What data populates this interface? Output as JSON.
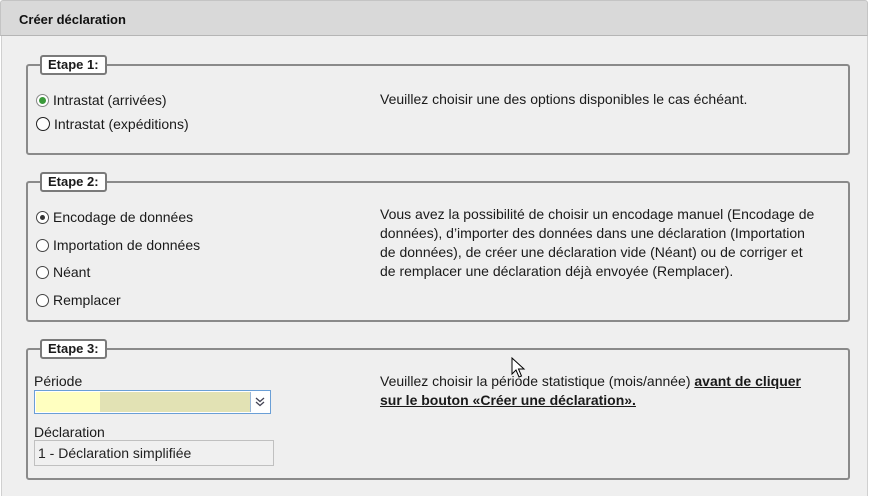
{
  "header": {
    "title": "Créer déclaration"
  },
  "step1": {
    "legend": "Etape 1:",
    "options": [
      {
        "label": "Intrastat (arrivées)",
        "selected": true
      },
      {
        "label": "Intrastat (expéditions)",
        "selected": false
      }
    ],
    "description": "Veuillez choisir une des options disponibles le cas échéant."
  },
  "step2": {
    "legend": "Etape 2:",
    "options": [
      {
        "label": "Encodage de données",
        "selected": true
      },
      {
        "label": "Importation de données",
        "selected": false
      },
      {
        "label": "Néant",
        "selected": false
      },
      {
        "label": "Remplacer",
        "selected": false
      }
    ],
    "description": "Vous avez la possibilité de choisir un encodage manuel (Encodage de données), d’importer des données dans une déclaration (Importation de données), de créer une déclaration vide (Néant) ou de corriger et de remplacer une déclaration déjà envoyée (Remplacer)."
  },
  "step3": {
    "legend": "Etape 3:",
    "period_label": "Période",
    "period_value": "",
    "declaration_label": "Déclaration",
    "declaration_value": "1 - Déclaration simplifiée",
    "description_plain": "Veuillez choisir la période statistique (mois/année) ",
    "description_bold": "avant de cliquer sur le bouton «Créer une déclaration»."
  },
  "colors": {
    "selected_radio_green": "#3a9a3a",
    "select_border": "#6a9fd6",
    "highlight_yellow": "#ffffc0"
  },
  "icons": {
    "select_toggle": "chevron-double-down-icon",
    "cursor": "arrow-cursor-icon"
  }
}
